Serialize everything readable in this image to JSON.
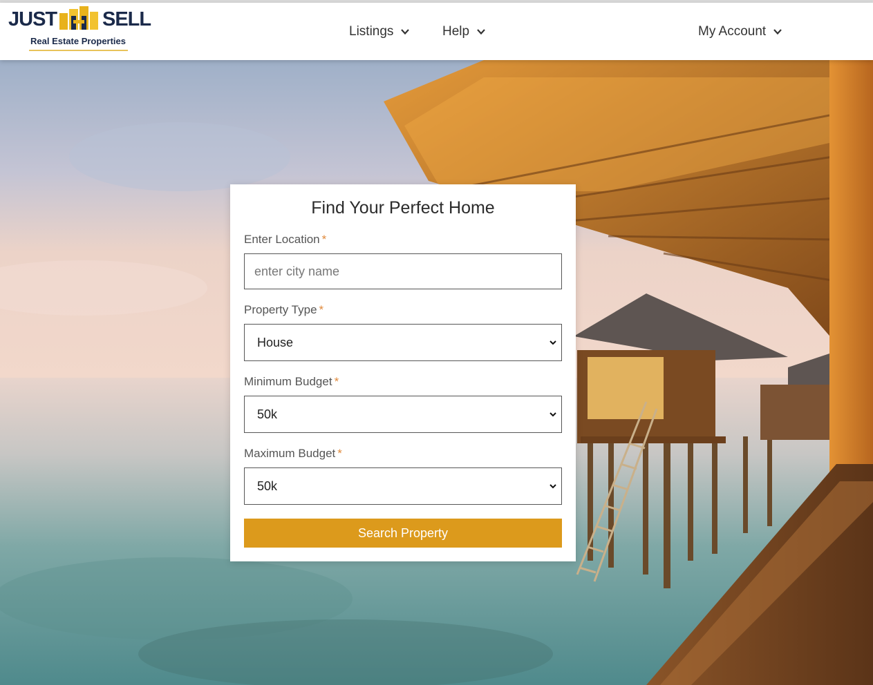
{
  "brand": {
    "word_left": "JUST",
    "word_right": "SELL",
    "tagline": "Real Estate Properties",
    "primary_color": "#1b2a4a",
    "accent_color": "#e8b21c"
  },
  "nav": {
    "items": [
      {
        "label": "Listings",
        "icon": "chevron-down-icon"
      },
      {
        "label": "Help",
        "icon": "chevron-down-icon"
      },
      {
        "label": "My Account",
        "icon": "chevron-down-icon"
      }
    ]
  },
  "search_form": {
    "title": "Find Your Perfect Home",
    "required_marker": "*",
    "location": {
      "label": "Enter Location",
      "placeholder": "enter city name",
      "value": ""
    },
    "property_type": {
      "label": "Property Type",
      "selected": "House"
    },
    "min_budget": {
      "label": "Minimum Budget",
      "selected": "50k"
    },
    "max_budget": {
      "label": "Maximum Budget",
      "selected": "50k"
    },
    "submit_label": "Search Property",
    "button_color": "#dc9a1c"
  },
  "hero": {
    "image": "overwater-bungalow-sunset-photo"
  }
}
